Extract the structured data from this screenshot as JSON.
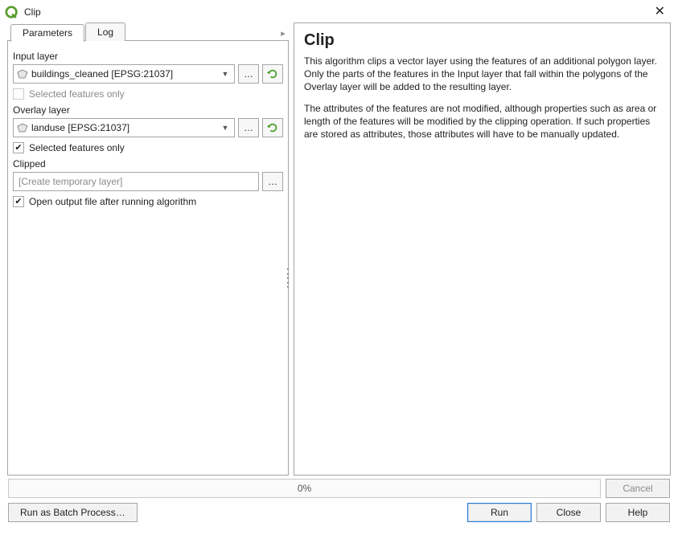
{
  "window": {
    "title": "Clip"
  },
  "tabs": {
    "parameters": "Parameters",
    "log": "Log",
    "active": "parameters"
  },
  "fields": {
    "input_layer": {
      "label": "Input layer",
      "value": "buildings_cleaned [EPSG:21037]",
      "selected_only": {
        "label": "Selected features only",
        "checked": false,
        "enabled": false
      }
    },
    "overlay_layer": {
      "label": "Overlay layer",
      "value": "landuse [EPSG:21037]",
      "selected_only": {
        "label": "Selected features only",
        "checked": true,
        "enabled": true
      }
    },
    "clipped": {
      "label": "Clipped",
      "placeholder": "[Create temporary layer]"
    },
    "open_output": {
      "label": "Open output file after running algorithm",
      "checked": true
    }
  },
  "help": {
    "title": "Clip",
    "p1": "This algorithm clips a vector layer using the features of an additional polygon layer. Only the parts of the features in the Input layer that fall within the polygons of the Overlay layer will be added to the resulting layer.",
    "p2": "The attributes of the features are not modified, although properties such as area or length of the features will be modified by the clipping operation. If such properties are stored as attributes, those attributes will have to be manually updated."
  },
  "progress": {
    "text": "0%"
  },
  "buttons": {
    "cancel": "Cancel",
    "batch": "Run as Batch Process…",
    "run": "Run",
    "close": "Close",
    "help": "Help",
    "browse": "…"
  }
}
